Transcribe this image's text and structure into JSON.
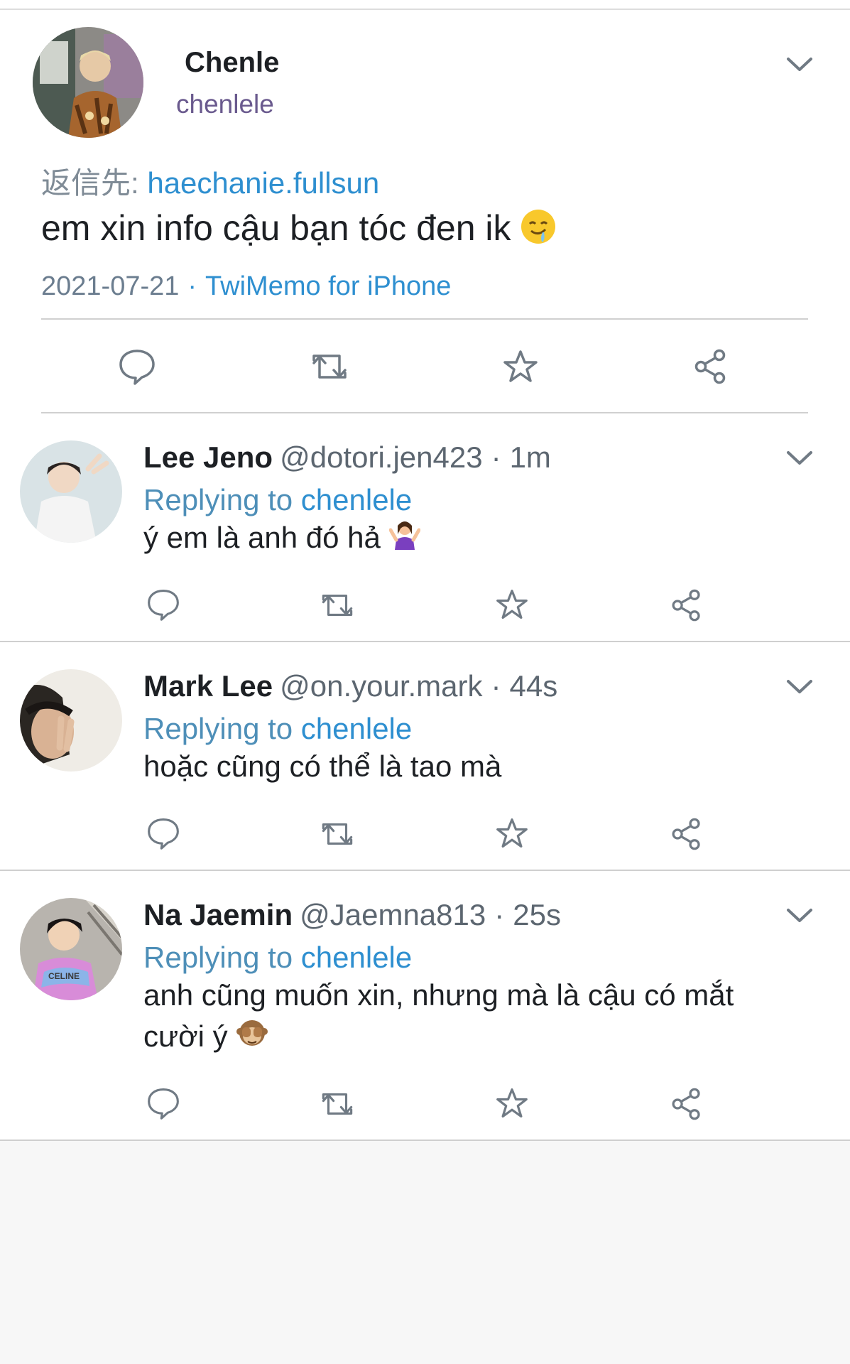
{
  "main_tweet": {
    "display_name": "Chenle",
    "username": "chenlele",
    "reply_to_prefix": "返信先:",
    "reply_to_user": "haechanie.fullsun",
    "text": "em xin info cậu bạn tóc đen ik",
    "text_emoji": "drooling-face",
    "date": "2021-07-21",
    "separator": "·",
    "client": "TwiMemo for iPhone"
  },
  "replies": [
    {
      "name": "Lee Jeno",
      "handle": "@dotori.jen423",
      "separator": "·",
      "time": "1m",
      "replying_prefix": "Replying to",
      "replying_user": "chenlele",
      "text": "ý em là anh đó hả",
      "text_emoji": "person-shrugging"
    },
    {
      "name": "Mark Lee",
      "handle": "@on.your.mark",
      "separator": "·",
      "time": "44s",
      "replying_prefix": "Replying to",
      "replying_user": "chenlele",
      "text": "hoặc cũng có thể là tao mà",
      "text_emoji": ""
    },
    {
      "name": "Na Jaemin",
      "handle": "@Jaemna813",
      "separator": "·",
      "time": "25s",
      "replying_prefix": "Replying to",
      "replying_user": "chenlele",
      "text": "anh cũng muốn xin, nhưng mà là cậu có mắt cười ý",
      "text_emoji": "see-no-evil-monkey"
    }
  ],
  "colors": {
    "link": "#2e8fd0",
    "icon": "#707a84",
    "divider": "#d0d0d0",
    "background": "#f7f7f7"
  }
}
